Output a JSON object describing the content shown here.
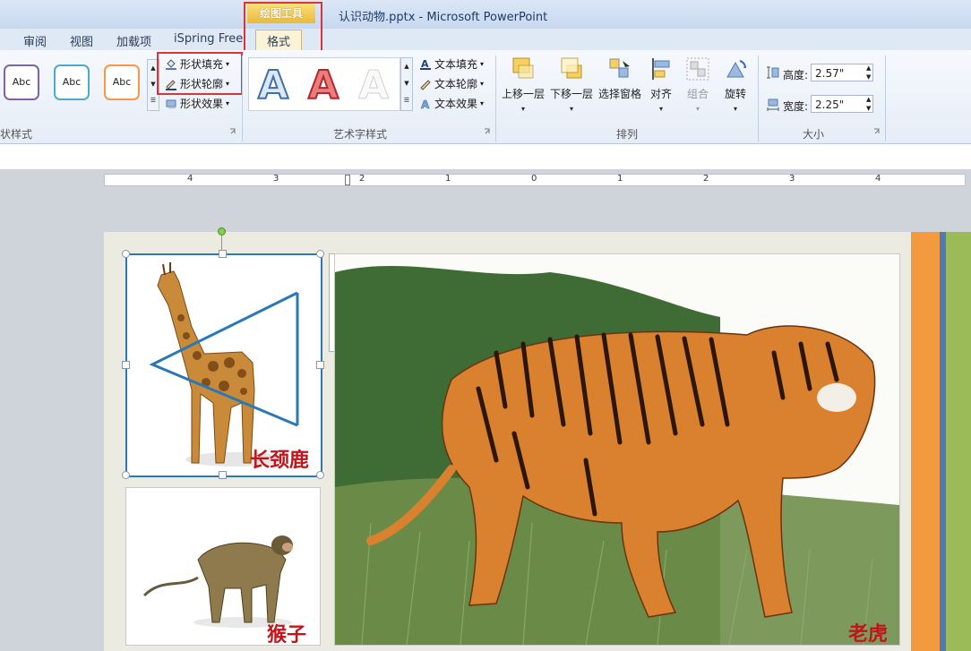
{
  "window": {
    "title": "认识动物.pptx  -  Microsoft PowerPoint"
  },
  "context_tab": {
    "group": "绘图工具",
    "tab": "格式"
  },
  "tabs": [
    "审阅",
    "视图",
    "加载项",
    "iSpring Free"
  ],
  "ribbon": {
    "shape_styles": {
      "label": "状样式",
      "swatches": [
        {
          "text": "Abc",
          "color": "#8064a2"
        },
        {
          "text": "Abc",
          "color": "#4bacc6"
        },
        {
          "text": "Abc",
          "color": "#f79646"
        }
      ],
      "fill": "形状填充",
      "outline": "形状轮廓",
      "effects": "形状效果"
    },
    "wordart_styles": {
      "label": "艺术字样式",
      "letter": "A",
      "text_fill": "文本填充",
      "text_outline": "文本轮廓",
      "text_effects": "文本效果"
    },
    "arrange": {
      "label": "排列",
      "bring_forward": "上移一层",
      "send_backward": "下移一层",
      "selection_pane": "选择窗格",
      "align": "对齐",
      "group": "组合",
      "rotate": "旋转"
    },
    "size": {
      "label": "大小",
      "height_label": "高度:",
      "height_value": "2.57\"",
      "width_label": "宽度:",
      "width_value": "2.25\""
    }
  },
  "ruler": {
    "marks": [
      "4",
      "3",
      "2",
      "1",
      "0",
      "1",
      "2",
      "3",
      "4"
    ]
  },
  "slide": {
    "labels": {
      "giraffe": "长颈鹿",
      "monkey": "猴子",
      "tiger": "老虎"
    },
    "colors": {
      "orange": "#f39a3e",
      "blue": "#4e7ab8",
      "green": "#9bbb59",
      "label_red": "#c0161b"
    }
  }
}
